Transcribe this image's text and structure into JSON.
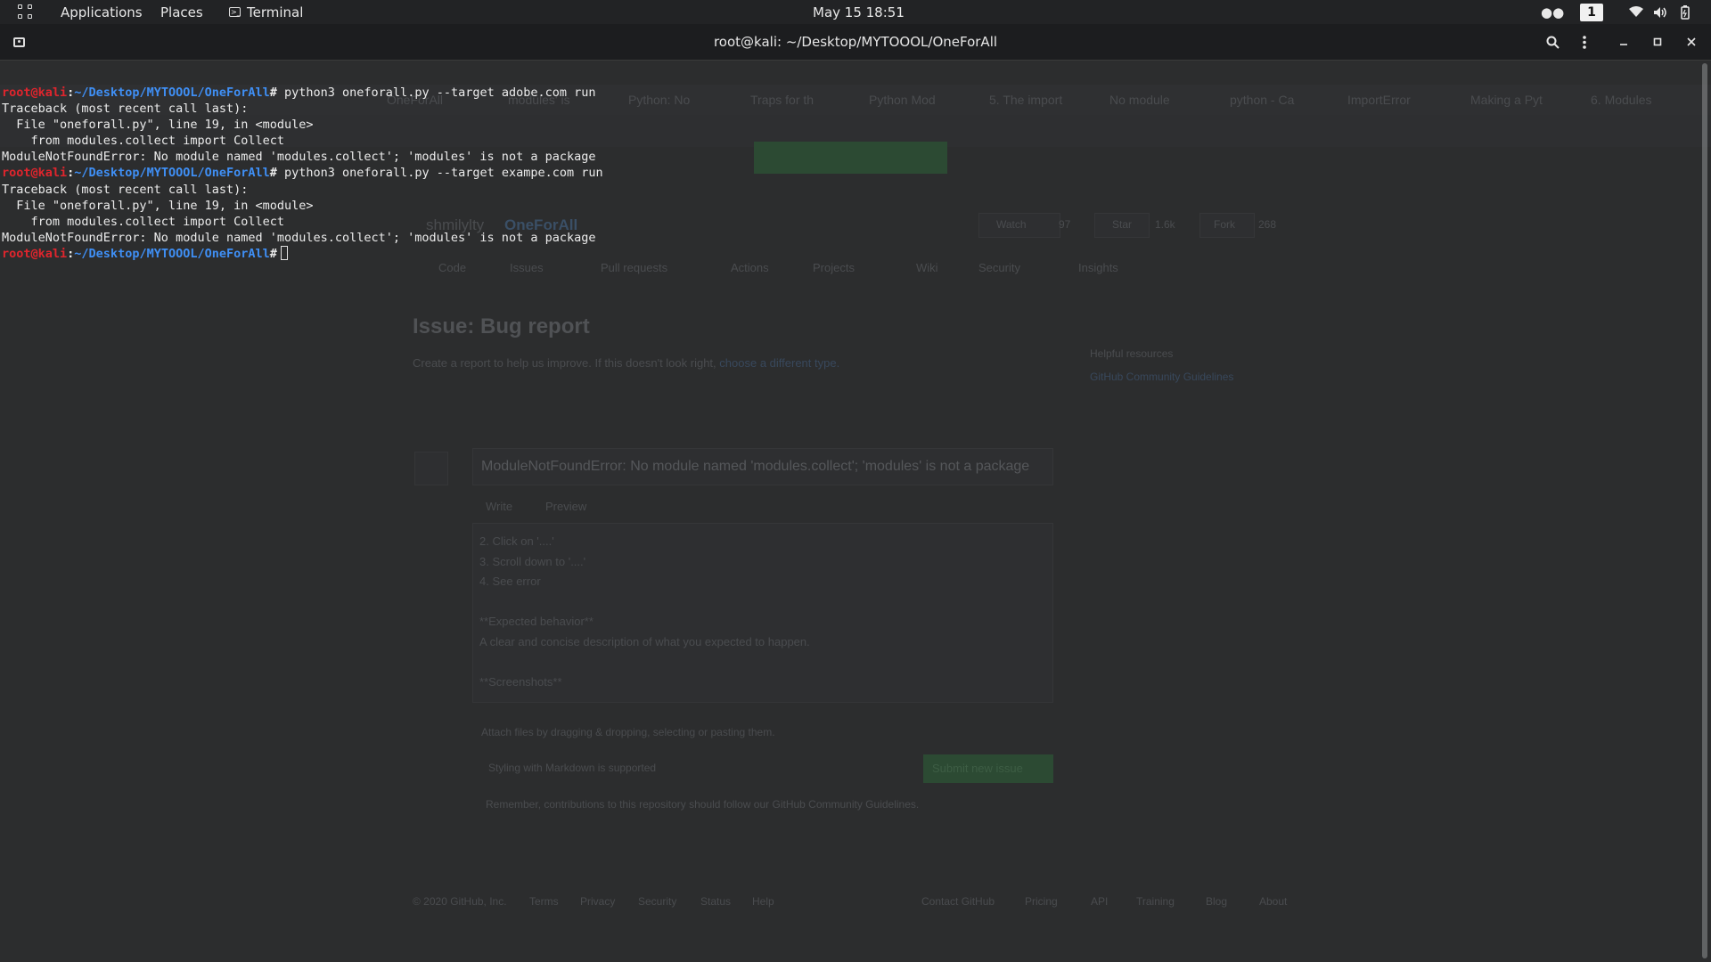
{
  "topbar": {
    "applications": "Applications",
    "places": "Places",
    "terminal": "Terminal",
    "clock": "May 15  18:51",
    "workspace": "1",
    "icons": [
      "apps-grid-icon",
      "terminal-icon",
      "people-icon",
      "wifi-icon",
      "volume-icon",
      "battery-icon"
    ]
  },
  "window": {
    "title": "root@kali: ~/Desktop/MYTOOOL/OneForAll",
    "buttons": [
      "new-tab-icon",
      "search-icon",
      "menu-icon",
      "minimize-icon",
      "maximize-icon",
      "close-icon"
    ]
  },
  "terminal": {
    "prompt_user": "root@kali",
    "prompt_sep": ":",
    "prompt_path": "~/Desktop/MYTOOOL/OneForAll",
    "prompt_end": "#",
    "lines": [
      {
        "type": "prompt",
        "cmd": " python3 oneforall.py --target adobe.com run"
      },
      {
        "type": "out",
        "text": "Traceback (most recent call last):"
      },
      {
        "type": "out",
        "text": "  File \"oneforall.py\", line 19, in <module>"
      },
      {
        "type": "out",
        "text": "    from modules.collect import Collect"
      },
      {
        "type": "out",
        "text": "ModuleNotFoundError: No module named 'modules.collect'; 'modules' is not a package"
      },
      {
        "type": "prompt",
        "cmd": " python3 oneforall.py --target exampe.com run"
      },
      {
        "type": "out",
        "text": "Traceback (most recent call last):"
      },
      {
        "type": "out",
        "text": "  File \"oneforall.py\", line 19, in <module>"
      },
      {
        "type": "out",
        "text": "    from modules.collect import Collect"
      },
      {
        "type": "out",
        "text": "ModuleNotFoundError: No module named 'modules.collect'; 'modules' is not a package"
      },
      {
        "type": "prompt",
        "cmd": ""
      }
    ]
  },
  "background_browser": {
    "tabs": [
      "OneForAll",
      "modules' is",
      "Python: No",
      "Traps for th",
      "Python Mod",
      "5. The import",
      "No module",
      "python - Ca",
      "ImportError",
      "Making a Pyt",
      "6. Modules"
    ],
    "repo_owner": "shmilylty",
    "repo_name": "OneForAll",
    "watch": "Watch",
    "watch_count": "97",
    "star": "Star",
    "star_count": "1.6k",
    "fork": "Fork",
    "fork_count": "268",
    "repo_tabs": [
      "Code",
      "Issues",
      "Pull requests",
      "Actions",
      "Projects",
      "Wiki",
      "Security",
      "Insights"
    ],
    "issue_heading": "Issue: Bug report",
    "issue_sub": "Create a report to help us improve. If this doesn't look right,",
    "issue_sub_link": "choose a different type.",
    "issue_title": "ModuleNotFoundError: No module named 'modules.collect'; 'modules' is not a package",
    "editor_tabs": [
      "Write",
      "Preview"
    ],
    "body_lines": [
      "2. Click on '....'",
      "3. Scroll down to '....'",
      "4. See error",
      "",
      "**Expected behavior**",
      "A clear and concise description of what you expected to happen.",
      "",
      "**Screenshots**"
    ],
    "attach_hint": "Attach files by dragging & dropping, selecting or pasting them.",
    "markdown_hint": "Styling with Markdown is supported",
    "submit": "Submit new issue",
    "guidelines": "Remember, contributions to this repository should follow our GitHub Community Guidelines.",
    "sidebar_heading": "Helpful resources",
    "sidebar_link": "GitHub Community Guidelines",
    "footer_links": [
      "© 2020 GitHub, Inc.",
      "Terms",
      "Privacy",
      "Security",
      "Status",
      "Help",
      "Contact GitHub",
      "Pricing",
      "API",
      "Training",
      "Blog",
      "About"
    ]
  }
}
